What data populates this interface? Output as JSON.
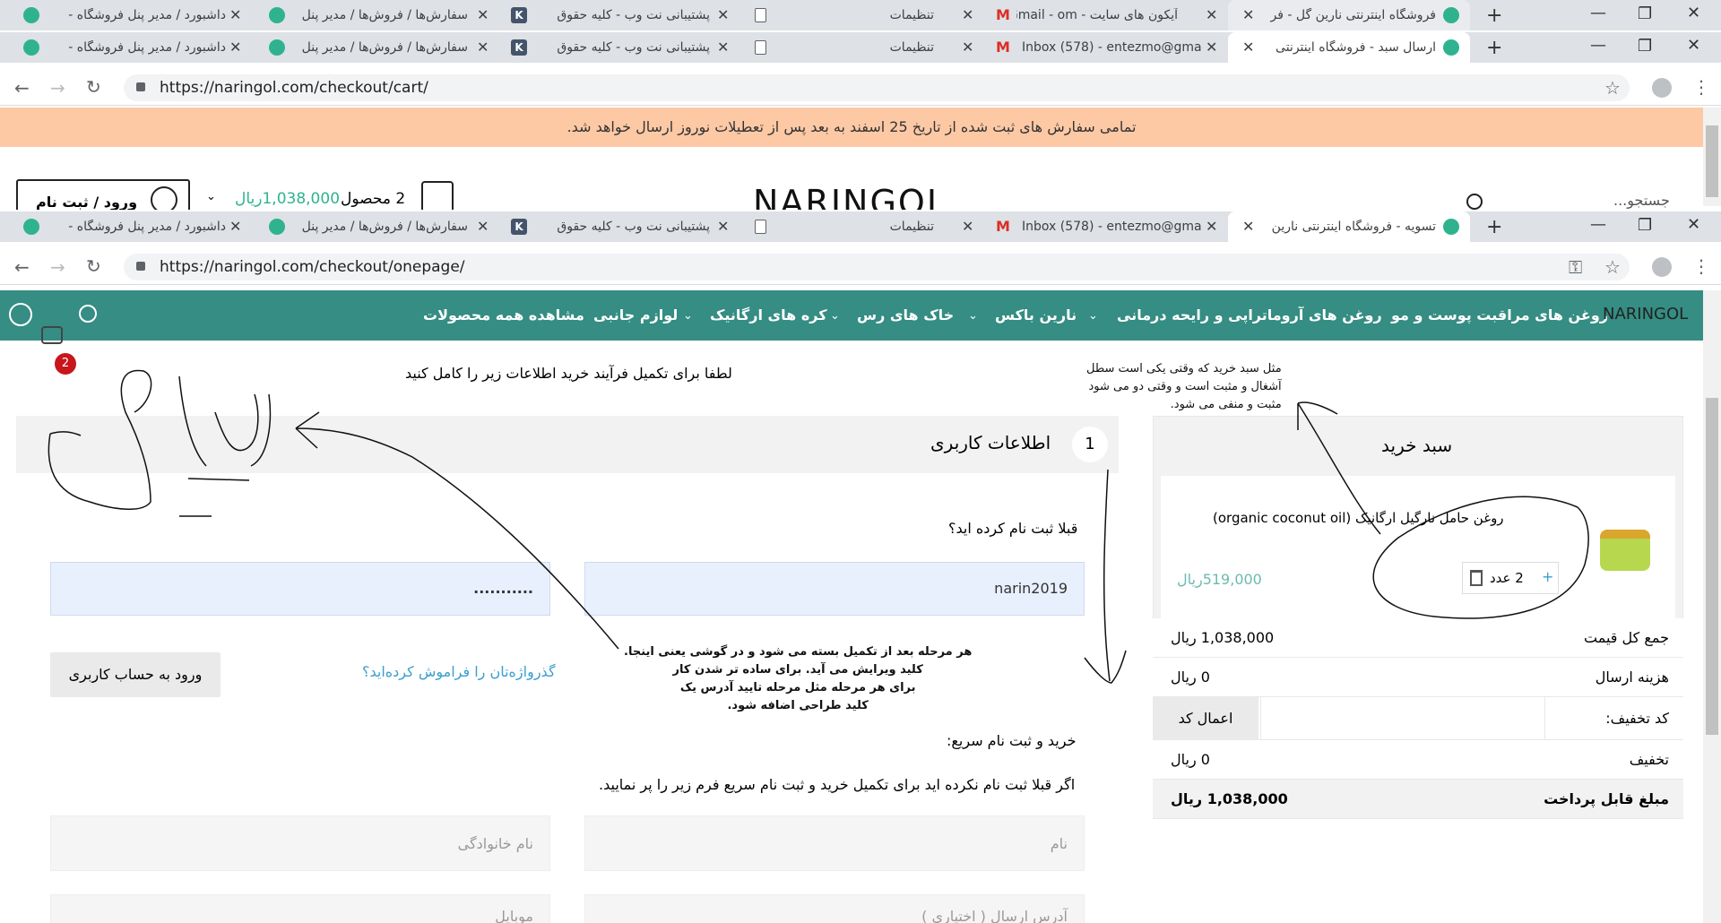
{
  "browser_tabs_row1": [
    {
      "title": "فروشگاه اینترنتی نارین گل - فر",
      "active": false
    },
    {
      "title": "آیکون های سایت - Gmail - om",
      "active": false
    },
    {
      "title": "تنظیمات",
      "active": false
    },
    {
      "title": "پشتیبانی نت وب - کلیه حقوق",
      "active": false
    },
    {
      "title": "سفارش‌ها / فروش‌ها / مدیر پنل",
      "active": false
    },
    {
      "title": "داشبورد / مدیر پنل فروشگاه -",
      "active": false
    }
  ],
  "browser_tabs_row2": [
    {
      "title": "ارسال سبد - فروشگاه اینترنتی",
      "active": true
    },
    {
      "title": "Inbox (578) - entezmo@gma",
      "active": false
    },
    {
      "title": "تنظیمات",
      "active": false
    },
    {
      "title": "پشتیبانی نت وب - کلیه حقوق",
      "active": false
    },
    {
      "title": "سفارش‌ها / فروش‌ها / مدیر پنل",
      "active": false
    },
    {
      "title": "داشبورد / مدیر پنل فروشگاه -",
      "active": false
    }
  ],
  "browser_tabs_row3": [
    {
      "title": "تسویه - فروشگاه اینترنتی نارین",
      "active": true
    },
    {
      "title": "Inbox (578) - entezmo@gma",
      "active": false
    },
    {
      "title": "تنظیمات",
      "active": false
    },
    {
      "title": "پشتیبانی نت وب - کلیه حقوق",
      "active": false
    },
    {
      "title": "سفارش‌ها / فروش‌ها / مدیر پنل",
      "active": false
    },
    {
      "title": "داشبورد / مدیر پنل فروشگاه -",
      "active": false
    }
  ],
  "url_cart": "https://naringol.com/checkout/cart/",
  "url_onepage": "https://naringol.com/checkout/onepage/",
  "promo_text": "تمامی سفارش های ثبت شده از تاریخ 25 اسفند به بعد پس از تعطیلات نوروز ارسال خواهد شد.",
  "header": {
    "login_label": "ورود / ثبت نام",
    "cart_count": "2 محصول",
    "cart_total": "1,038,000ریال",
    "logo": "NARINGOL",
    "search_placeholder": "جستجو..."
  },
  "nav": {
    "logo": "NARINGOL",
    "items": [
      "روغن های مراقبت پوست و مو",
      "روغن های آروماتراپی و رایحه درمانی",
      "نارین باکس",
      "خاک های رس",
      "کره های ارگانیک",
      "لوازم جانبی",
      "مشاهده همه محصولات"
    ],
    "cart_badge": "2"
  },
  "checkout": {
    "subtitle": "لطفا برای تکمیل فرآیند خرید اطلاعات زیر را کامل کنید",
    "step_number": "1",
    "step_title": "اطلاعات کاربری",
    "registered_question": "قبلا ثبت نام کرده اید؟",
    "username_value": "narin2019",
    "password_value": "...........",
    "forgot_link": "گذرواژه‌تان را فراموش کرده‌اید؟",
    "login_button": "ورود به حساب کاربری",
    "quick_title": "خرید و ثبت نام سریع:",
    "quick_desc": "اگر قبلا ثبت نام نکرده اید برای تکمیل خرید و ثبت نام سریع فرم زیر را پر نمایید.",
    "first_name_placeholder": "نام",
    "last_name_placeholder": "نام خانوادگی",
    "address_placeholder": "آدرس ارسال ( اختیاری )",
    "mobile_placeholder": "موبایل"
  },
  "cart": {
    "title": "سبد خرید",
    "product_name": "روغن حامل نارگیل ارگانیک (organic coconut oil)",
    "product_price": "519,000ریال",
    "qty_label": "2 عدد",
    "plus": "+",
    "subtotal_label": "جمع کل قیمت",
    "subtotal_value": "1,038,000 ریال",
    "shipping_label": "هزینه ارسال",
    "shipping_value": "0 ریال",
    "coupon_label": "کد تخفیف:",
    "coupon_button": "اعمال کد",
    "discount_label": "تخفیف",
    "discount_value": "0 ریال",
    "payable_label": "مبلغ قابل پرداخت",
    "payable_value": "1,038,000 ریال"
  },
  "annotations": {
    "note_cart": [
      "مثل سبد خرید که وقتی یکی است سطل",
      "آشغال و مثبت است و وقتی دو می شود",
      "مثبت و منفی می شود."
    ],
    "note_step": [
      "هر مرحله بعد از تکمیل بسته می شود و در گوشی یعنی اینجا.",
      "کلید ویرایش می آید. برای ساده تر شدن کار",
      "برای هر مرحله مثل مرحله تایید آدرس یک",
      "کلید طراحی اضافه شود."
    ]
  }
}
